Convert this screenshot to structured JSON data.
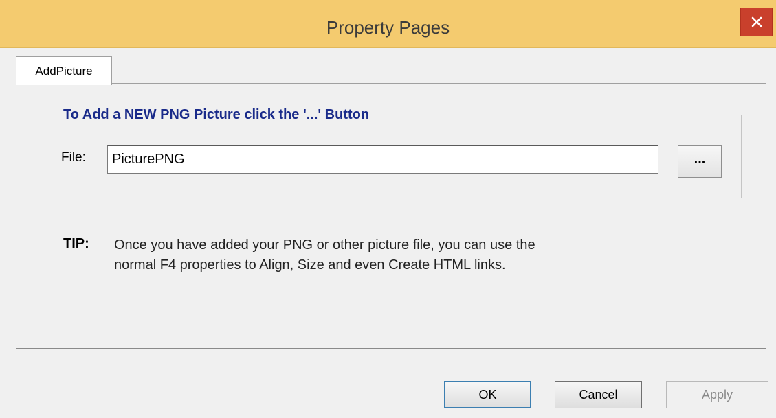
{
  "window": {
    "title": "Property Pages"
  },
  "tabs": [
    {
      "label": "AddPicture",
      "selected": true
    }
  ],
  "groupbox": {
    "legend": "To Add a NEW PNG Picture click the '...' Button"
  },
  "file": {
    "label": "File:",
    "value": "PicturePNG",
    "browse_label": "..."
  },
  "tip": {
    "label": "TIP:",
    "line1": "Once you have added your PNG or other picture file, you can use the",
    "line2": "normal F4 properties to Align, Size and even Create HTML links."
  },
  "buttons": {
    "ok": "OK",
    "cancel": "Cancel",
    "apply": "Apply"
  },
  "colors": {
    "titlebar": "#f4cb6f",
    "close_button": "#c9402c",
    "legend_text": "#1a2b8a"
  },
  "icons": {
    "close": "close-icon"
  }
}
